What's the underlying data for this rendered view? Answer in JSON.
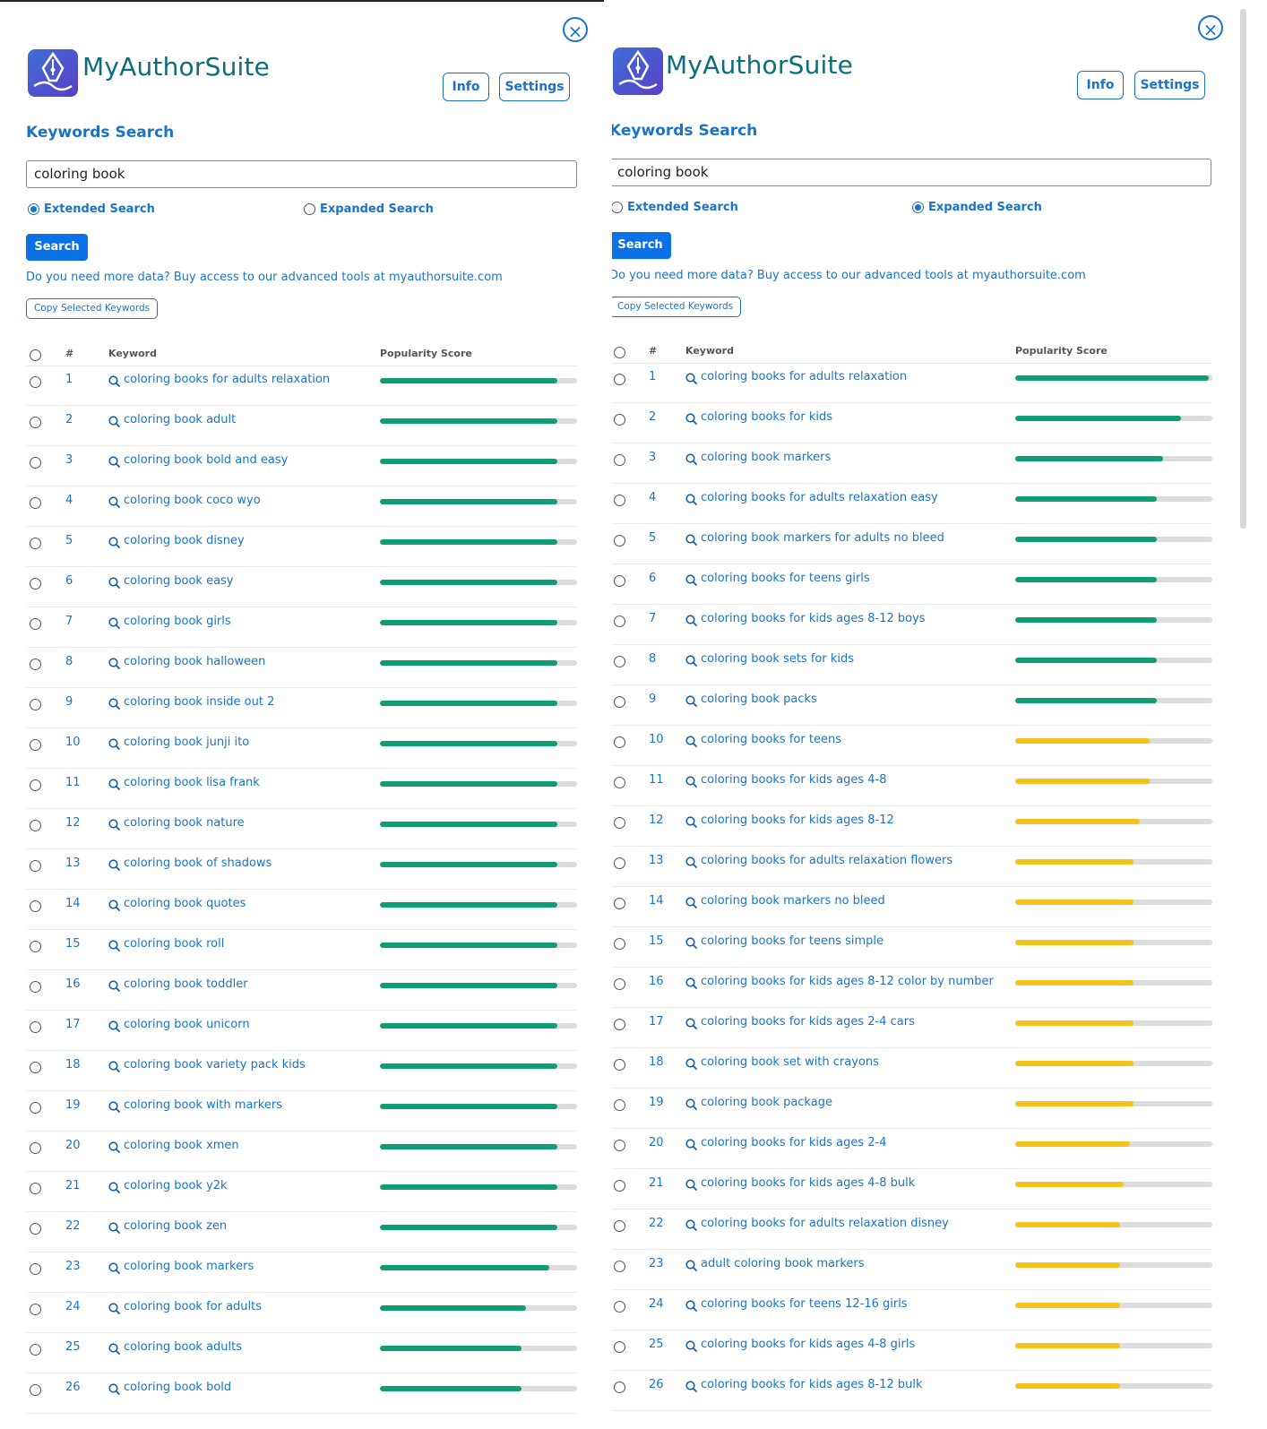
{
  "app": {
    "brand": "MyAuthorSuite",
    "close_icon": "×"
  },
  "buttons": {
    "info": "Info",
    "settings": "Settings",
    "search": "Search",
    "copy": "Copy Selected Keywords"
  },
  "section_title": "Keywords Search",
  "search": {
    "value": "coloring book"
  },
  "radio": {
    "extended": "Extended Search",
    "expanded": "Expanded Search"
  },
  "promo": "Do you need more data? Buy access to our advanced tools at myauthorsuite.com",
  "columns": {
    "num": "#",
    "keyword": "Keyword",
    "popularity": "Popularity Score"
  },
  "colors": {
    "accent": "#1a73c8",
    "button": "#0a72e6",
    "green": "#0f9d73",
    "yellow": "#f5c21b",
    "track": "#dcdcdc",
    "brand": "#0b6e7a"
  },
  "left": {
    "mode": "extended",
    "rows": [
      {
        "n": "1",
        "k": "coloring books for adults relaxation",
        "p": 0.9
      },
      {
        "n": "2",
        "k": "coloring book adult",
        "p": 0.9
      },
      {
        "n": "3",
        "k": "coloring book bold and easy",
        "p": 0.9
      },
      {
        "n": "4",
        "k": "coloring book coco wyo",
        "p": 0.9
      },
      {
        "n": "5",
        "k": "coloring book disney",
        "p": 0.9
      },
      {
        "n": "6",
        "k": "coloring book easy",
        "p": 0.9
      },
      {
        "n": "7",
        "k": "coloring book girls",
        "p": 0.9
      },
      {
        "n": "8",
        "k": "coloring book halloween",
        "p": 0.9
      },
      {
        "n": "9",
        "k": "coloring book inside out 2",
        "p": 0.9
      },
      {
        "n": "10",
        "k": "coloring book junji ito",
        "p": 0.9
      },
      {
        "n": "11",
        "k": "coloring book lisa frank",
        "p": 0.9
      },
      {
        "n": "12",
        "k": "coloring book nature",
        "p": 0.9
      },
      {
        "n": "13",
        "k": "coloring book of shadows",
        "p": 0.9
      },
      {
        "n": "14",
        "k": "coloring book quotes",
        "p": 0.9
      },
      {
        "n": "15",
        "k": "coloring book roll",
        "p": 0.9
      },
      {
        "n": "16",
        "k": "coloring book toddler",
        "p": 0.9
      },
      {
        "n": "17",
        "k": "coloring book unicorn",
        "p": 0.9
      },
      {
        "n": "18",
        "k": "coloring book variety pack kids",
        "p": 0.9
      },
      {
        "n": "19",
        "k": "coloring book with markers",
        "p": 0.9
      },
      {
        "n": "20",
        "k": "coloring book xmen",
        "p": 0.9
      },
      {
        "n": "21",
        "k": "coloring book y2k",
        "p": 0.9
      },
      {
        "n": "22",
        "k": "coloring book zen",
        "p": 0.9
      },
      {
        "n": "23",
        "k": "coloring book markers",
        "p": 0.86
      },
      {
        "n": "24",
        "k": "coloring book for adults",
        "p": 0.74
      },
      {
        "n": "25",
        "k": "coloring book adults",
        "p": 0.72
      },
      {
        "n": "26",
        "k": "coloring book bold",
        "p": 0.72
      }
    ]
  },
  "right": {
    "mode": "expanded",
    "rows": [
      {
        "n": "1",
        "k": "coloring books for adults relaxation",
        "p": 0.98,
        "c": "green"
      },
      {
        "n": "2",
        "k": "coloring books for kids",
        "p": 0.84,
        "c": "green"
      },
      {
        "n": "3",
        "k": "coloring book markers",
        "p": 0.75,
        "c": "green"
      },
      {
        "n": "4",
        "k": "coloring books for adults relaxation easy",
        "p": 0.72,
        "c": "green"
      },
      {
        "n": "5",
        "k": "coloring book markers for adults no bleed",
        "p": 0.72,
        "c": "green"
      },
      {
        "n": "6",
        "k": "coloring books for teens girls",
        "p": 0.72,
        "c": "green"
      },
      {
        "n": "7",
        "k": "coloring books for kids ages 8-12 boys",
        "p": 0.72,
        "c": "green"
      },
      {
        "n": "8",
        "k": "coloring book sets for kids",
        "p": 0.72,
        "c": "green"
      },
      {
        "n": "9",
        "k": "coloring book packs",
        "p": 0.72,
        "c": "green"
      },
      {
        "n": "10",
        "k": "coloring books for teens",
        "p": 0.68,
        "c": "yellow"
      },
      {
        "n": "11",
        "k": "coloring books for kids ages 4-8",
        "p": 0.68,
        "c": "yellow"
      },
      {
        "n": "12",
        "k": "coloring books for kids ages 8-12",
        "p": 0.63,
        "c": "yellow"
      },
      {
        "n": "13",
        "k": "coloring books for adults relaxation flowers",
        "p": 0.6,
        "c": "yellow"
      },
      {
        "n": "14",
        "k": "coloring book markers no bleed",
        "p": 0.6,
        "c": "yellow"
      },
      {
        "n": "15",
        "k": "coloring books for teens simple",
        "p": 0.6,
        "c": "yellow"
      },
      {
        "n": "16",
        "k": "coloring books for kids ages 8-12 color by number",
        "p": 0.6,
        "c": "yellow"
      },
      {
        "n": "17",
        "k": "coloring books for kids ages 2-4 cars",
        "p": 0.6,
        "c": "yellow"
      },
      {
        "n": "18",
        "k": "coloring book set with crayons",
        "p": 0.6,
        "c": "yellow"
      },
      {
        "n": "19",
        "k": "coloring book package",
        "p": 0.6,
        "c": "yellow"
      },
      {
        "n": "20",
        "k": "coloring books for kids ages 2-4",
        "p": 0.58,
        "c": "yellow"
      },
      {
        "n": "21",
        "k": "coloring books for kids ages 4-8 bulk",
        "p": 0.55,
        "c": "yellow"
      },
      {
        "n": "22",
        "k": "coloring books for adults relaxation disney",
        "p": 0.53,
        "c": "yellow"
      },
      {
        "n": "23",
        "k": "adult coloring book markers",
        "p": 0.53,
        "c": "yellow"
      },
      {
        "n": "24",
        "k": "coloring books for teens 12-16 girls",
        "p": 0.53,
        "c": "yellow"
      },
      {
        "n": "25",
        "k": "coloring books for kids ages 4-8 girls",
        "p": 0.53,
        "c": "yellow"
      },
      {
        "n": "26",
        "k": "coloring books for kids ages 8-12 bulk",
        "p": 0.53,
        "c": "yellow"
      }
    ]
  }
}
